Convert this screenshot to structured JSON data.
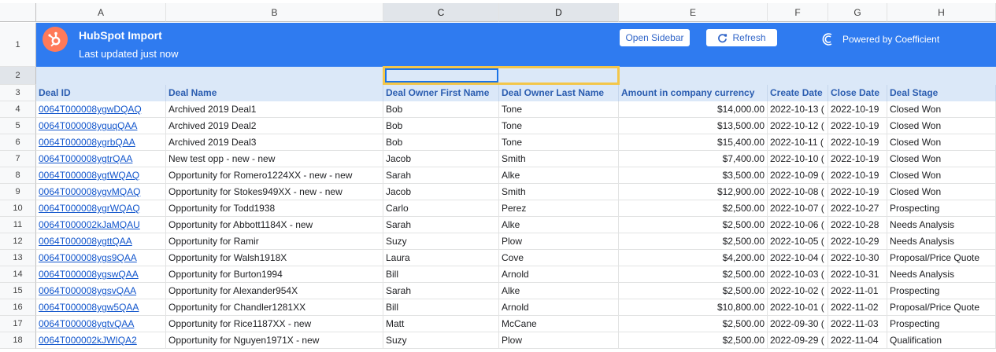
{
  "columns": [
    "A",
    "B",
    "C",
    "D",
    "E",
    "F",
    "G",
    "H"
  ],
  "banner": {
    "title": "HubSpot Import",
    "subtitle": "Last updated just now",
    "open_sidebar_label": "Open Sidebar",
    "refresh_label": "Refresh",
    "powered_label": "Powered by Coefficient"
  },
  "headers": [
    "Deal ID",
    "Deal Name",
    "Deal Owner First Name",
    "Deal Owner Last Name",
    "Amount in company currency",
    "Create Date",
    "Close Date",
    "Deal Stage"
  ],
  "rows": [
    {
      "n": "4",
      "id": "0064T000008ygwDQAQ",
      "name": "Archived 2019 Deal1",
      "first": "Bob",
      "last": "Tone",
      "amount": "$14,000.00",
      "created": "2022-10-13 (",
      "closed": "2022-10-19",
      "stage": "Closed Won"
    },
    {
      "n": "5",
      "id": "0064T000008yguqQAA",
      "name": "Archived 2019 Deal2",
      "first": "Bob",
      "last": "Tone",
      "amount": "$13,500.00",
      "created": "2022-10-12 (",
      "closed": "2022-10-19",
      "stage": "Closed Won"
    },
    {
      "n": "6",
      "id": "0064T000008ygrbQAA",
      "name": "Archived 2019 Deal3",
      "first": "Bob",
      "last": "Tone",
      "amount": "$15,400.00",
      "created": "2022-10-11 (",
      "closed": "2022-10-19",
      "stage": "Closed Won"
    },
    {
      "n": "7",
      "id": "0064T000008ygtrQAA",
      "name": "New test opp - new - new",
      "first": "Jacob",
      "last": "Smith",
      "amount": "$7,400.00",
      "created": "2022-10-10 (",
      "closed": "2022-10-19",
      "stage": "Closed Won"
    },
    {
      "n": "8",
      "id": "0064T000008ygtWQAQ",
      "name": "Opportunity for Romero1224XX - new - new",
      "first": "Sarah",
      "last": "Alke",
      "amount": "$3,500.00",
      "created": "2022-10-09 (",
      "closed": "2022-10-19",
      "stage": "Closed Won"
    },
    {
      "n": "9",
      "id": "0064T000008ygvMQAQ",
      "name": "Opportunity for Stokes949XX - new - new",
      "first": "Jacob",
      "last": "Smith",
      "amount": "$12,900.00",
      "created": "2022-10-08 (",
      "closed": "2022-10-19",
      "stage": "Closed Won"
    },
    {
      "n": "10",
      "id": "0064T000008ygrWQAQ",
      "name": "Opportunity for Todd1938",
      "first": "Carlo",
      "last": "Perez",
      "amount": "$2,500.00",
      "created": "2022-10-07 (",
      "closed": "2022-10-27",
      "stage": "Prospecting"
    },
    {
      "n": "11",
      "id": "0064T000002kJaMQAU",
      "name": "Opportunity for Abbott1184X - new",
      "first": "Sarah",
      "last": "Alke",
      "amount": "$2,500.00",
      "created": "2022-10-06 (",
      "closed": "2022-10-28",
      "stage": "Needs Analysis"
    },
    {
      "n": "12",
      "id": "0064T000008ygttQAA",
      "name": "Opportunity for Ramir",
      "first": "Suzy",
      "last": "Plow",
      "amount": "$2,500.00",
      "created": "2022-10-05 (",
      "closed": "2022-10-29",
      "stage": "Needs Analysis"
    },
    {
      "n": "13",
      "id": "0064T000008ygs9QAA",
      "name": "Opportunity for Walsh1918X",
      "first": "Laura",
      "last": "Cove",
      "amount": "$4,200.00",
      "created": "2022-10-04 (",
      "closed": "2022-10-30",
      "stage": "Proposal/Price Quote"
    },
    {
      "n": "14",
      "id": "0064T000008ygswQAA",
      "name": "Opportunity for Burton1994",
      "first": "Bill",
      "last": "Arnold",
      "amount": "$2,500.00",
      "created": "2022-10-03 (",
      "closed": "2022-10-31",
      "stage": "Needs Analysis"
    },
    {
      "n": "15",
      "id": "0064T000008ygsvQAA",
      "name": "Opportunity for Alexander954X",
      "first": "Sarah",
      "last": "Alke",
      "amount": "$2,500.00",
      "created": "2022-10-02 (",
      "closed": "2022-11-01",
      "stage": "Prospecting"
    },
    {
      "n": "16",
      "id": "0064T000008ygw5QAA",
      "name": "Opportunity for Chandler1281XX",
      "first": "Bill",
      "last": "Arnold",
      "amount": "$10,800.00",
      "created": "2022-10-01 (",
      "closed": "2022-11-02",
      "stage": "Proposal/Price Quote"
    },
    {
      "n": "17",
      "id": "0064T000008ygtvQAA",
      "name": "Opportunity for Rice1187XX - new",
      "first": "Matt",
      "last": "McCane",
      "amount": "$2,500.00",
      "created": "2022-09-30 (",
      "closed": "2022-11-03",
      "stage": "Prospecting"
    },
    {
      "n": "18",
      "id": "0064T000002kJWIQA2",
      "name": "Opportunity for Nguyen1971X - new",
      "first": "Suzy",
      "last": "Plow",
      "amount": "$2,500.00",
      "created": "2022-09-29 (",
      "closed": "2022-11-04",
      "stage": "Qualification"
    }
  ]
}
